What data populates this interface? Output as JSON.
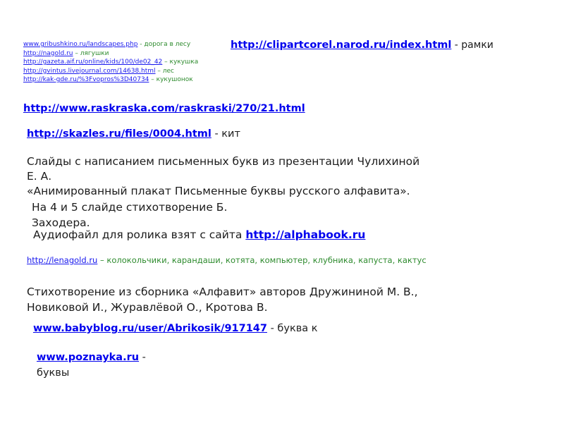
{
  "credits_small": [
    {
      "link": "www.gribushkino.ru/landscapes.php",
      "desc": " - дорога в лесу"
    },
    {
      "link": "http://nagold.ru",
      "desc": "  – лягушки"
    },
    {
      "link": "http://gazeta.aif.ru/online/kids/100/de02_42",
      "desc": "  – кукушка"
    },
    {
      "link": "http://gvintus.livejournal.com/14638.html",
      "desc": "  – лес"
    },
    {
      "link": "http://kak-gde.ru/%3Fvopros%3D40734",
      "desc": "  – кукушонок"
    }
  ],
  "clipartcorel": {
    "link": "http://clipartcorel.narod.ru/index.html",
    "desc": " - рамки"
  },
  "raskraska": {
    "link": "http://www.raskraska.com/raskraski/270/21.html"
  },
  "skazles": {
    "link": "http://skazles.ru/files/0004.html",
    "desc": "  - кит"
  },
  "slides_text": {
    "line1": "Слайды с написанием письменных букв из презентации Чулихиной",
    "line2": "Е. А.",
    "line3": "«Анимированный плакат Письменные буквы русского алфавита»."
  },
  "poem_text": {
    "line1": "На 4 и 5 слайде стихотворение Б.",
    "line2": "Заходера."
  },
  "audio": {
    "prefix": "Аудиофайл для ролика взят с сайта ",
    "link": "http://alphabook.ru"
  },
  "lenagold": {
    "link": "http://lenagold.ru",
    "desc": " – колокольчики, карандаши, котята, компьютер, клубника, капуста, кактус"
  },
  "collection": {
    "line1": "Стихотворение из сборника «Алфавит» авторов Дружининой М. В.,",
    "line2": "Новиковой И., Журавлёвой О., Кротова В."
  },
  "babyblog": {
    "link": "www.babyblog.ru/user/Abrikosik/917147",
    "desc": " - буква к"
  },
  "poznayka": {
    "link": "www.poznayka.ru",
    "desc": " -",
    "desc2": "буквы"
  }
}
